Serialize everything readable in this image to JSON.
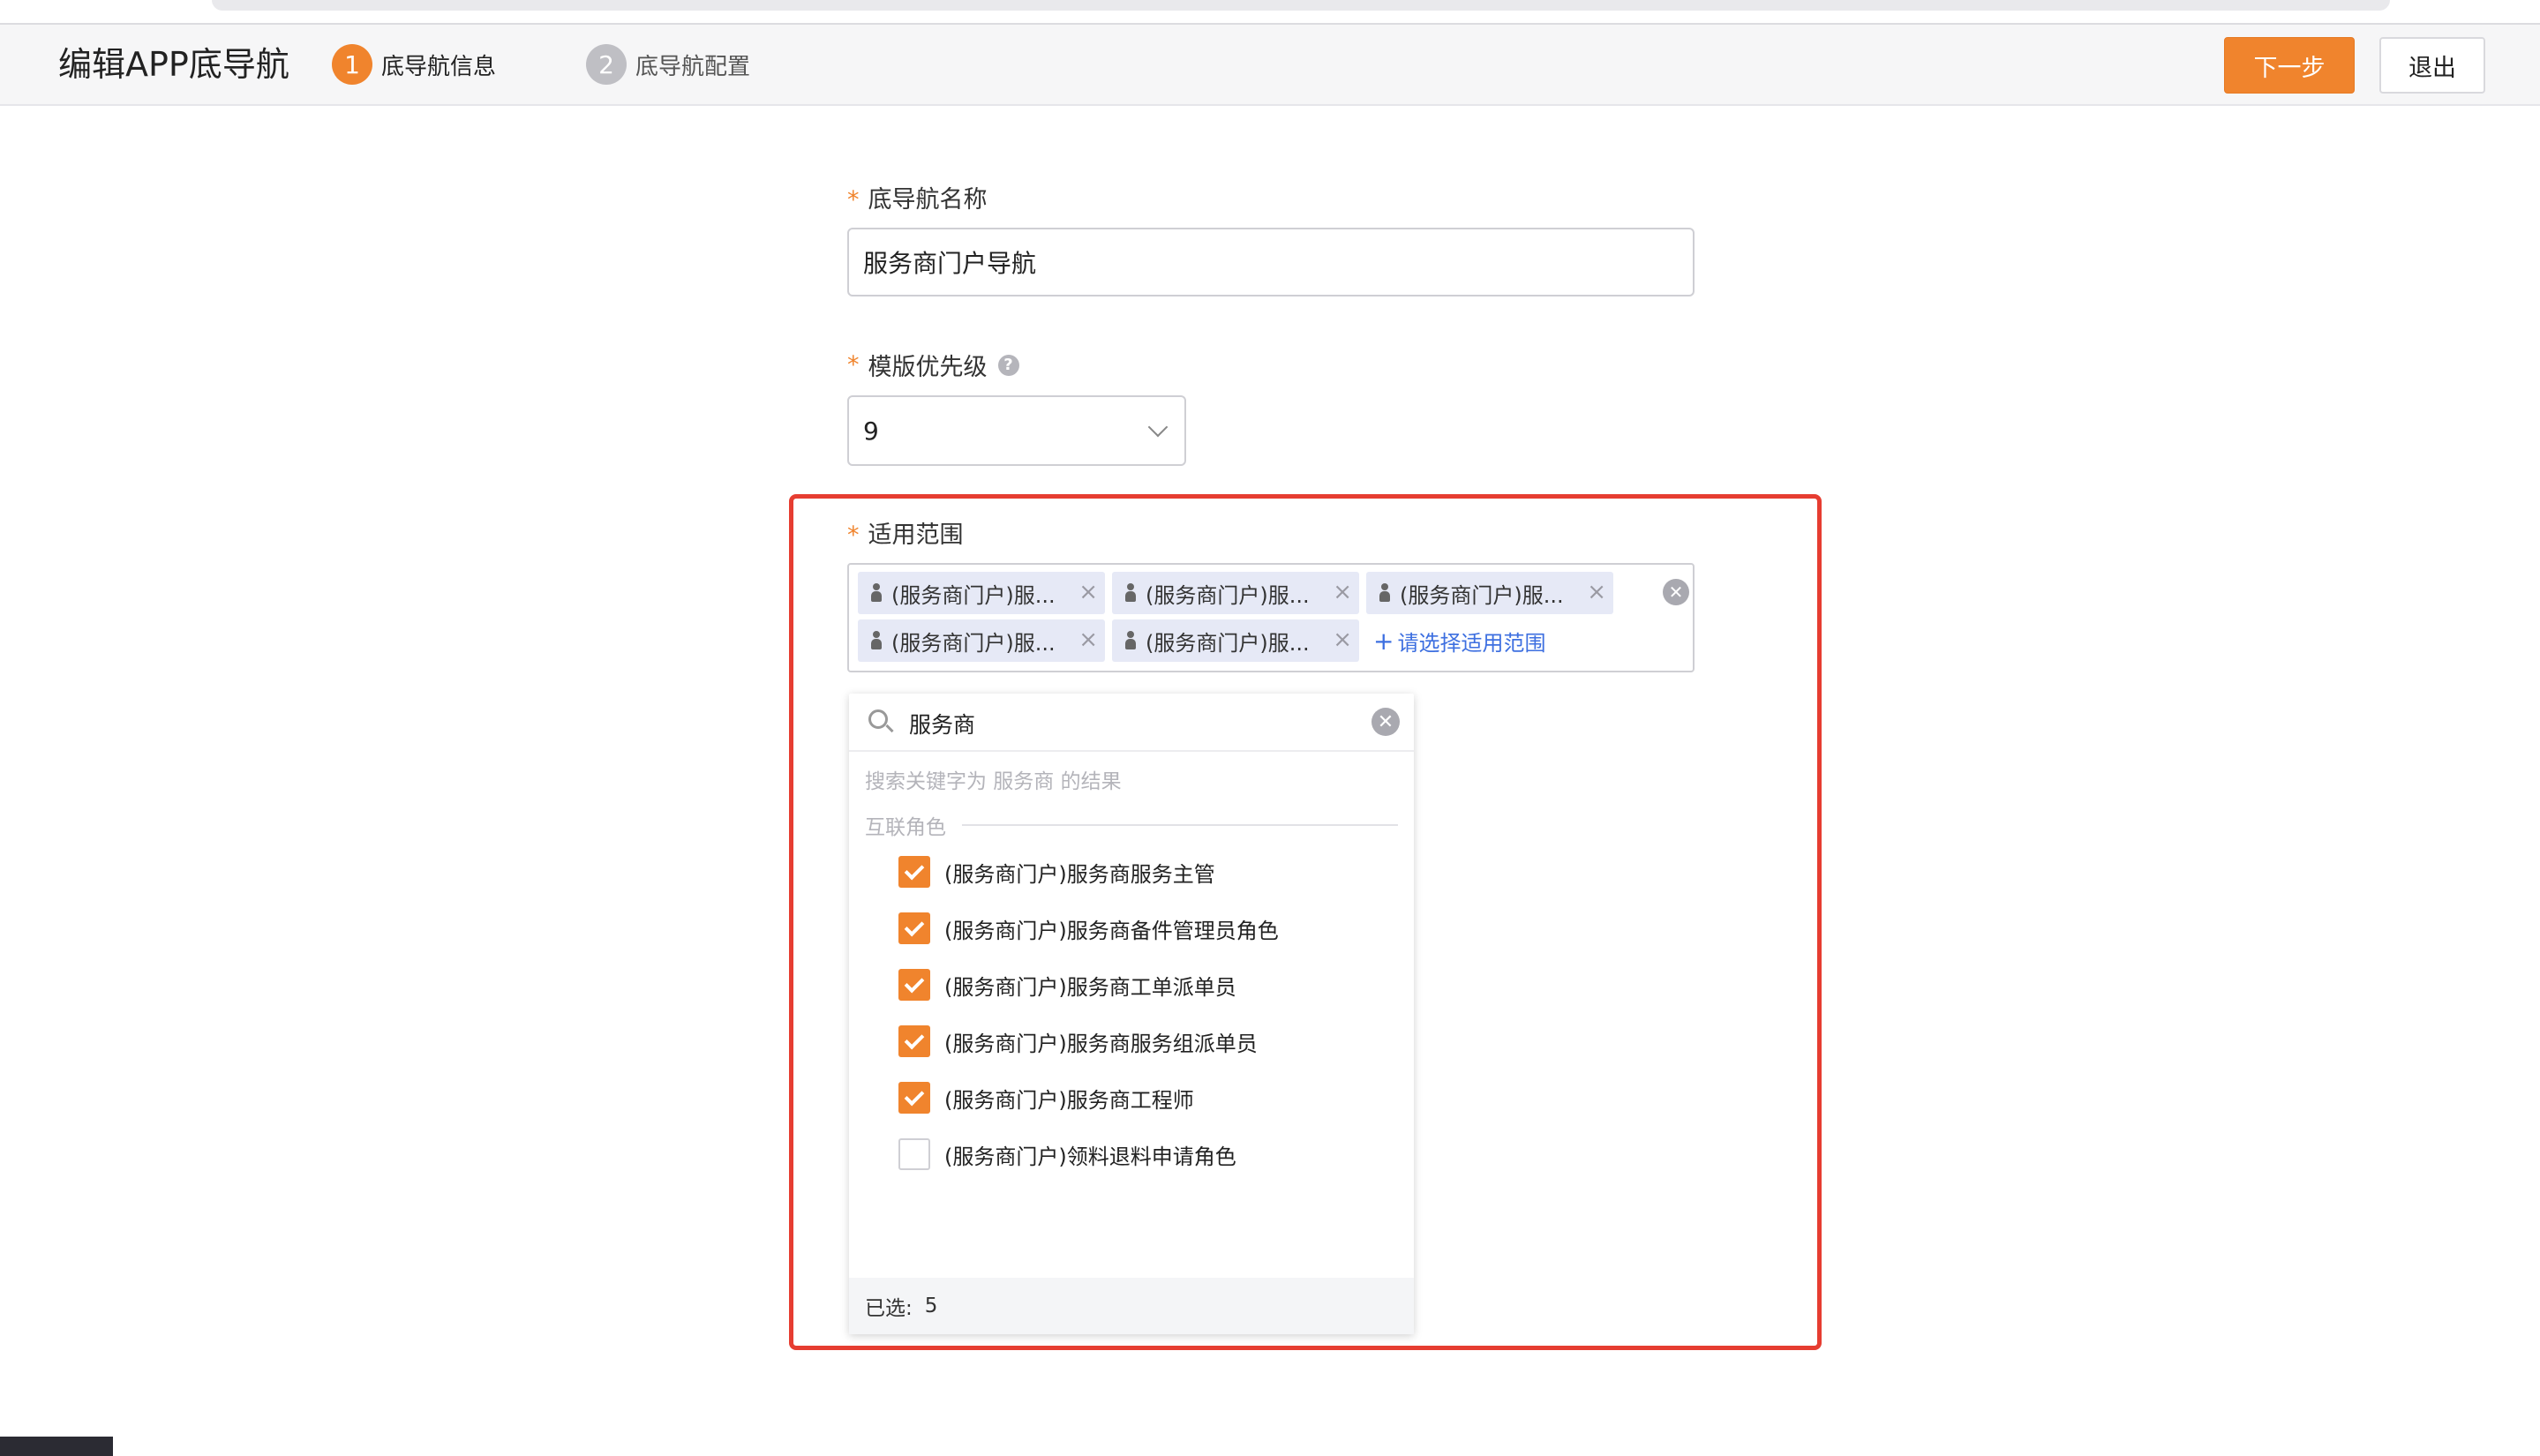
{
  "header": {
    "title": "编辑APP底导航",
    "steps": [
      {
        "number": "1",
        "label": "底导航信息"
      },
      {
        "number": "2",
        "label": "底导航配置"
      }
    ],
    "next_label": "下一步",
    "exit_label": "退出"
  },
  "form": {
    "required_mark": "*",
    "name_label": "底导航名称",
    "name_value": "服务商门户导航",
    "priority_label": "模版优先级",
    "priority_help_icon": "question-circle-icon",
    "priority_value": "9",
    "scope_label": "适用范围",
    "scope_tags": [
      "(服务商门户)服...",
      "(服务商门户)服...",
      "(服务商门户)服...",
      "(服务商门户)服...",
      "(服务商门户)服..."
    ],
    "add_scope_label": "请选择适用范围",
    "add_scope_plus": "+"
  },
  "dropdown": {
    "search_value": "服务商",
    "hint": "搜索关键字为 服务商 的结果",
    "group_title": "互联角色",
    "options": [
      {
        "label": "(服务商门户)服务商服务主管",
        "checked": true
      },
      {
        "label": "(服务商门户)服务商备件管理员角色",
        "checked": true
      },
      {
        "label": "(服务商门户)服务商工单派单员",
        "checked": true
      },
      {
        "label": "(服务商门户)服务商服务组派单员",
        "checked": true
      },
      {
        "label": "(服务商门户)服务商工程师",
        "checked": true
      },
      {
        "label": "(服务商门户)领料退料申请角色",
        "checked": false
      }
    ],
    "selected_label": "已选:",
    "selected_count": "5"
  },
  "colors": {
    "accent": "#f0842d",
    "highlight": "#e63d31",
    "link": "#3d6fe0",
    "tag_bg": "#e6e9f6"
  }
}
